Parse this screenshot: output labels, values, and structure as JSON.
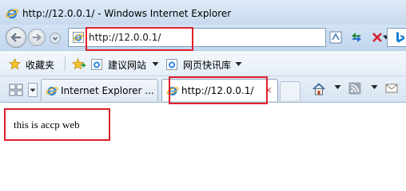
{
  "window": {
    "title": "http://12.0.0.1/ - Windows Internet Explorer"
  },
  "address_bar": {
    "url": "http://12.0.0.1/"
  },
  "favorites_bar": {
    "favorites_label": "收藏夹",
    "items": [
      {
        "label": "建议网站",
        "icon": "ie-page-icon"
      },
      {
        "label": "网页快讯库",
        "icon": "ie-page-icon"
      }
    ]
  },
  "tabs": [
    {
      "label": "Internet Explorer ...",
      "active": false
    },
    {
      "label": "http://12.0.0.1/",
      "active": true,
      "close_glyph": "×"
    }
  ],
  "page": {
    "body_text": "this is accp web"
  },
  "colors": {
    "annotation": "#e0202a",
    "chrome": "#d3e3f5",
    "ie_blue": "#1e6fd6"
  }
}
